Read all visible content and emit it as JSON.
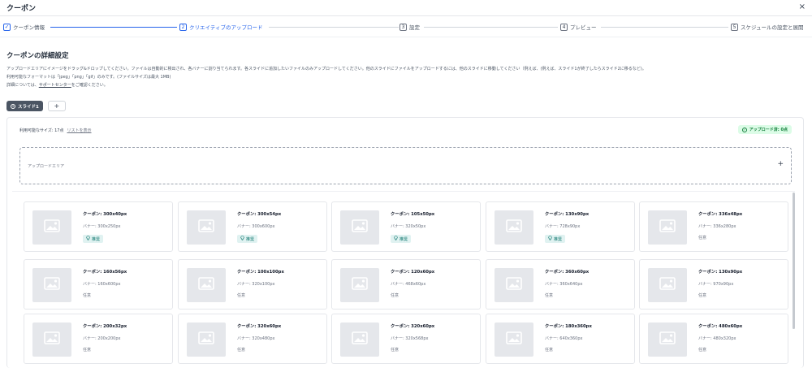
{
  "window": {
    "title": "クーポン",
    "close_glyph": "×"
  },
  "stepper": [
    {
      "num": "✓",
      "label": "クーポン情報",
      "state": "done"
    },
    {
      "num": "2",
      "label": "クリエイティブのアップロード",
      "state": "active"
    },
    {
      "num": "3",
      "label": "設定",
      "state": "todo"
    },
    {
      "num": "4",
      "label": "プレビュー",
      "state": "todo"
    },
    {
      "num": "5",
      "label": "スケジュールの設定と展開",
      "state": "todo"
    }
  ],
  "section": {
    "title": "クーポンの詳細設定",
    "desc1": "アップロードエリアにイメージをドラッグ&ドロップしてください。ファイルは自動的に検出され、各バナーに割り当てられます。各スライドに追加したいファイルのみアップロードしてください。他のスライドにファイルをアップロードするには、他のスライドに移動してください（例えば、(例えば、スライド1が終了したらスライド2に移るなど)。",
    "desc2": "利用可能なフォーマットは「jpeg」「png」「gif」のみです。(ファイルサイズは最大 1MB)",
    "desc3_before": "詳細については、",
    "desc3_link": "サポートセンター",
    "desc3_after": "をご確認ください。"
  },
  "slides": {
    "active_label": "スライド1",
    "add_glyph": "+"
  },
  "panel": {
    "available_sizes": "利用可能なサイズ: 17点",
    "show_list": "リストを表示",
    "uploaded": "アップロード済: 0点",
    "upload_area_label": "アップロードエリア",
    "upload_plus": "+"
  },
  "cards": [
    {
      "name": "クーポン: 300x40px",
      "banner": "バナー: 300x250px",
      "tag": "推奨"
    },
    {
      "name": "クーポン: 300x54px",
      "banner": "バナー: 300x600px",
      "tag": "推奨"
    },
    {
      "name": "クーポン: 105x50px",
      "banner": "バナー: 320x50px",
      "tag": "推奨"
    },
    {
      "name": "クーポン: 130x90px",
      "banner": "バナー: 728x90px",
      "tag": "推奨"
    },
    {
      "name": "クーポン: 336x48px",
      "banner": "バナー: 336x280px",
      "tag": "任意"
    },
    {
      "name": "クーポン: 160x56px",
      "banner": "バナー: 160x600px",
      "tag": "任意"
    },
    {
      "name": "クーポン: 100x100px",
      "banner": "バナー: 320x100px",
      "tag": "任意"
    },
    {
      "name": "クーポン: 120x60px",
      "banner": "バナー: 468x60px",
      "tag": "任意"
    },
    {
      "name": "クーポン: 360x60px",
      "banner": "バナー: 360x640px",
      "tag": "任意"
    },
    {
      "name": "クーポン: 130x90px",
      "banner": "バナー: 970x90px",
      "tag": "任意"
    },
    {
      "name": "クーポン: 200x32px",
      "banner": "バナー: 200x200px",
      "tag": "任意"
    },
    {
      "name": "クーポン: 320x60px",
      "banner": "バナー: 320x480px",
      "tag": "任意"
    },
    {
      "name": "クーポン: 320x60px",
      "banner": "バナー: 320x568px",
      "tag": "任意"
    },
    {
      "name": "クーポン: 180x360px",
      "banner": "バナー: 640x360px",
      "tag": "任意"
    },
    {
      "name": "クーポン: 480x60px",
      "banner": "バナー: 480x320px",
      "tag": "任意"
    }
  ],
  "colors": {
    "accent": "#2563eb",
    "success_bg": "#dcfce7",
    "success_text": "#15803d",
    "recommended_bg": "#e0f2f1",
    "recommended_text": "#0f766e"
  },
  "icons": {
    "image_placeholder": "image-icon",
    "recommended": "lightbulb-icon",
    "uploaded": "check-circle-icon",
    "slide": "info-circle-icon"
  }
}
